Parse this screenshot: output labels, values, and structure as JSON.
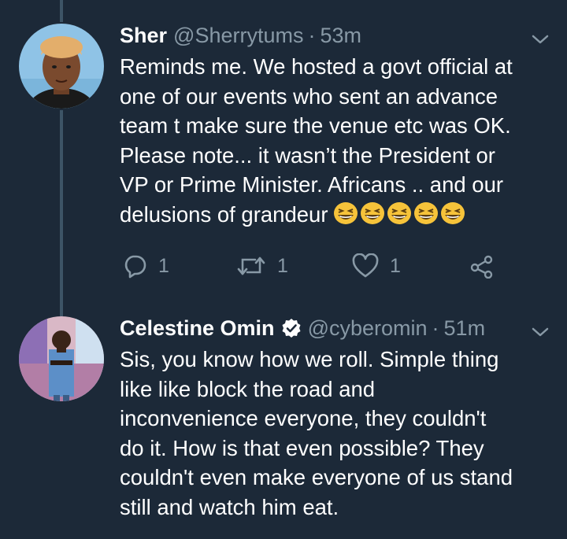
{
  "tweets": [
    {
      "name": "Sher",
      "handle": "@Sherrytums",
      "separator": "·",
      "time": "53m",
      "verified": false,
      "lines": [
        "Reminds me. We hosted a govt official at",
        "one of our events who sent an advance",
        "team t make sure the venue etc was OK.",
        "Please note... it wasn’t the President or",
        "VP or Prime Minister. Africans .. and our",
        "delusions of grandeur"
      ],
      "emoji": [
        "grinning-squinting-face",
        "grinning-squinting-face",
        "grinning-squinting-face",
        "grinning-squinting-face",
        "grinning-squinting-face"
      ],
      "replies": "1",
      "retweets": "1",
      "likes": "1"
    },
    {
      "name": "Celestine Omin",
      "handle": "@cyberomin",
      "separator": "·",
      "time": "51m",
      "verified": true,
      "lines": [
        "Sis, you know how we roll. Simple thing",
        "like like block the road and",
        "inconvenience everyone, they couldn't",
        "do it. How is that even possible? They",
        "couldn't even make everyone of us stand",
        "still and watch him eat."
      ]
    }
  ],
  "colors": {
    "background": "#1c2938",
    "text": "#ffffff",
    "secondary": "#8899a6",
    "thread_line": "#3d5466",
    "emoji": "#f6c33a"
  }
}
